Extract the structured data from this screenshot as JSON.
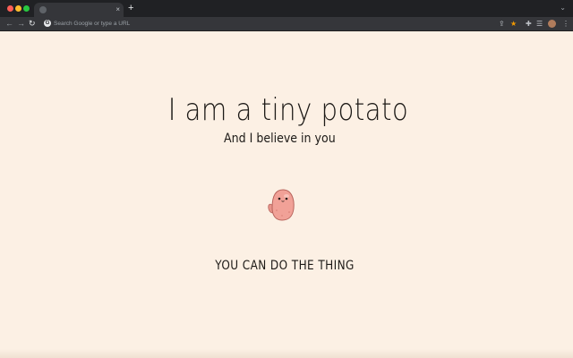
{
  "browser": {
    "tab": {
      "title": "",
      "close_glyph": "×"
    },
    "new_tab_glyph": "+",
    "tab_menu_glyph": "⌄",
    "nav": {
      "back_glyph": "←",
      "forward_glyph": "→",
      "reload_glyph": "↻"
    },
    "omnibox": {
      "placeholder": "Search Google or type a URL",
      "search_engine_glyph": "G"
    },
    "toolbar_icons": [
      "share-icon",
      "star-icon",
      "extensions-icon",
      "media-controls-icon",
      "profile-avatar",
      "more-menu-icon"
    ],
    "toolbar_glyphs": {
      "share": "⇪",
      "star": "★",
      "extensions": "✚",
      "media": "☰",
      "menu": "⋮"
    },
    "colors": {
      "accent_star": "#f29900",
      "chrome_dark": "#202124",
      "toolbar": "#35363a"
    }
  },
  "page": {
    "title": "I am a tiny potato",
    "subtitle": "And I believe in you",
    "cta": "YOU CAN DO THE THING",
    "background_color": "#fcf0e4",
    "illustration": "tiny-potato"
  }
}
